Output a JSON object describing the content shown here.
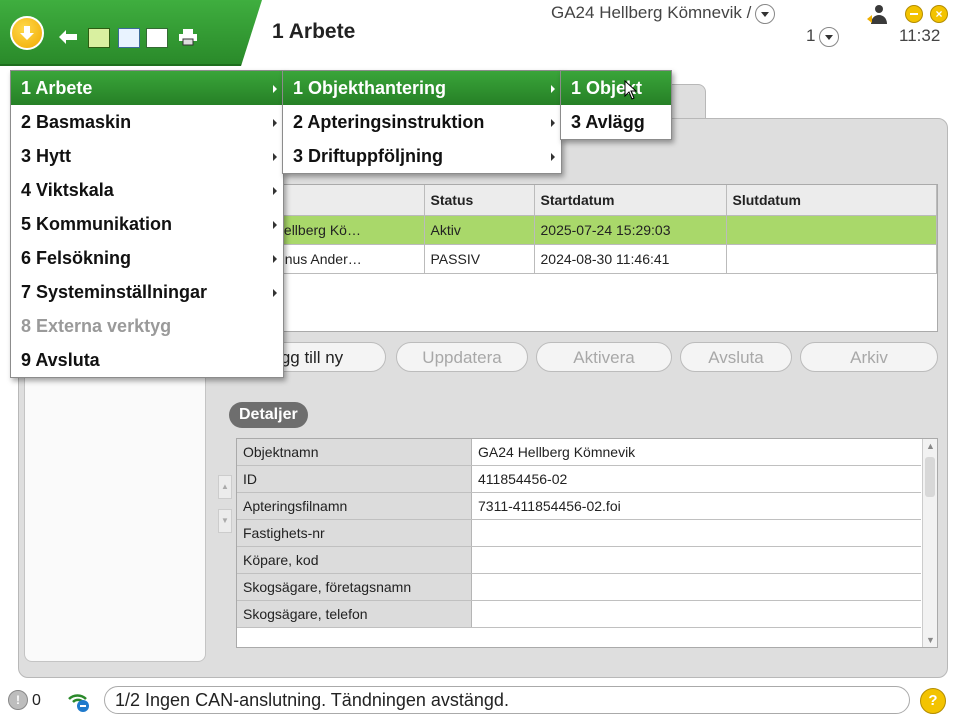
{
  "header": {
    "page_title": "1 Arbete",
    "object_title": "GA24 Hellberg Kömnevik /",
    "page_number": "1",
    "clock": "11:32",
    "close_symbol": "×",
    "accent_color": "#2f9a2f"
  },
  "tab": {
    "label": "g"
  },
  "menus": {
    "level1": [
      {
        "label": "1 Arbete",
        "highlighted": true,
        "enabled": true,
        "submenu": true
      },
      {
        "label": "2 Basmaskin",
        "highlighted": false,
        "enabled": true,
        "submenu": true
      },
      {
        "label": "3 Hytt",
        "highlighted": false,
        "enabled": true,
        "submenu": true
      },
      {
        "label": "4 Viktskala",
        "highlighted": false,
        "enabled": true,
        "submenu": true
      },
      {
        "label": "5 Kommunikation",
        "highlighted": false,
        "enabled": true,
        "submenu": true
      },
      {
        "label": "6 Felsökning",
        "highlighted": false,
        "enabled": true,
        "submenu": true
      },
      {
        "label": "7 Systeminställningar",
        "highlighted": false,
        "enabled": true,
        "submenu": true
      },
      {
        "label": "8 Externa verktyg",
        "highlighted": false,
        "enabled": false,
        "submenu": false
      },
      {
        "label": "9 Avsluta",
        "highlighted": false,
        "enabled": true,
        "submenu": false
      }
    ],
    "level2": [
      {
        "label": "1 Objekthantering",
        "highlighted": true
      },
      {
        "label": "2 Apteringsinstruktion",
        "highlighted": false
      },
      {
        "label": "3 Driftuppföljning",
        "highlighted": false
      }
    ],
    "level3": [
      {
        "label": "1 Objekt",
        "highlighted": true
      },
      {
        "label": "3 Avlägg",
        "highlighted": false
      }
    ]
  },
  "object_list": {
    "columns": [
      "amn",
      "Status",
      "Startdatum",
      "Slutdatum"
    ],
    "rows": [
      {
        "name": "A24 Hellberg Kö…",
        "status": "Aktiv",
        "start": "2025-07-24 15:29:03",
        "end": "",
        "selected": true
      },
      {
        "name": "A Magnus Ander…",
        "status": "PASSIV",
        "start": "2024-08-30 11:46:41",
        "end": "",
        "selected": false
      }
    ]
  },
  "actions": {
    "add": "gg till ny",
    "update": "Uppdatera",
    "activate": "Aktivera",
    "finish": "Avsluta",
    "archive": "Arkiv"
  },
  "details": {
    "section_label": "Detaljer",
    "rows": [
      {
        "key": "Objektnamn",
        "value": "GA24 Hellberg Kömnevik"
      },
      {
        "key": "ID",
        "value": "411854456-02"
      },
      {
        "key": "Apteringsfilnamn",
        "value": "7311-411854456-02.foi"
      },
      {
        "key": "Fastighets-nr",
        "value": ""
      },
      {
        "key": "Köpare, kod",
        "value": ""
      },
      {
        "key": "Skogsägare, företagsnamn",
        "value": ""
      },
      {
        "key": "Skogsägare, telefon",
        "value": ""
      }
    ]
  },
  "statusbar": {
    "alarm_symbol": "!",
    "alarm_count": "0",
    "message": "1/2 Ingen CAN-anslutning. Tändningen avstängd.",
    "help_symbol": "?"
  }
}
